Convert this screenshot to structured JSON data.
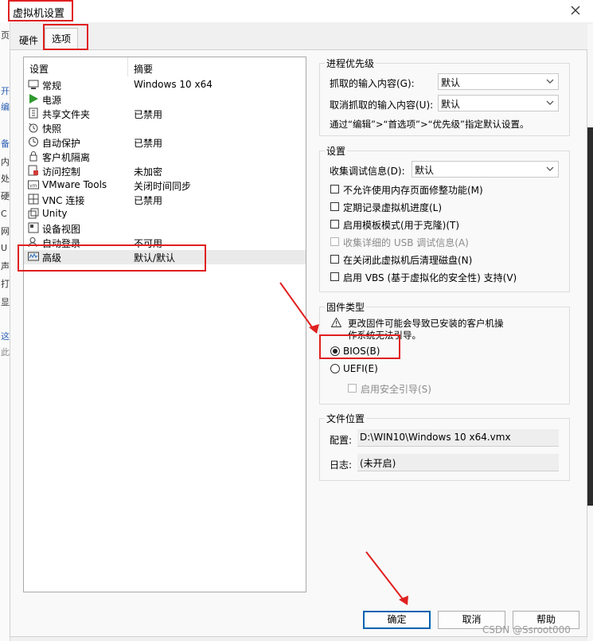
{
  "window": {
    "title": "虚拟机设置"
  },
  "tabs": [
    {
      "label": "硬件"
    },
    {
      "label": "选项"
    }
  ],
  "settings_list": {
    "col_setting": "设置",
    "col_summary": "摘要",
    "items": [
      {
        "name": "常规",
        "summary": "Windows 10 x64",
        "icon": "general-icon"
      },
      {
        "name": "电源",
        "summary": "",
        "icon": "power-icon"
      },
      {
        "name": "共享文件夹",
        "summary": "已禁用",
        "icon": "shared-folder-icon"
      },
      {
        "name": "快照",
        "summary": "",
        "icon": "snapshot-icon"
      },
      {
        "name": "自动保护",
        "summary": "已禁用",
        "icon": "autoprotect-icon"
      },
      {
        "name": "客户机隔离",
        "summary": "",
        "icon": "isolation-icon"
      },
      {
        "name": "访问控制",
        "summary": "未加密",
        "icon": "access-control-icon"
      },
      {
        "name": "VMware Tools",
        "summary": "关闭时间同步",
        "icon": "vmware-tools-icon"
      },
      {
        "name": "VNC 连接",
        "summary": "已禁用",
        "icon": "vnc-icon"
      },
      {
        "name": "Unity",
        "summary": "",
        "icon": "unity-icon"
      },
      {
        "name": "设备视图",
        "summary": "",
        "icon": "device-view-icon"
      },
      {
        "name": "自动登录",
        "summary": "不可用",
        "icon": "autologin-icon"
      },
      {
        "name": "高级",
        "summary": "默认/默认",
        "icon": "advanced-icon"
      }
    ]
  },
  "process_priority": {
    "title": "进程优先级",
    "grabbed_label": "抓取的输入内容(G):",
    "grabbed_value": "默认",
    "ungrabbed_label": "取消抓取的输入内容(U):",
    "ungrabbed_value": "默认",
    "hint": "通过“编辑”>“首选项”>“优先级”指定默认设置。"
  },
  "settings_group": {
    "title": "设置",
    "collect_label": "收集调试信息(D):",
    "collect_value": "默认",
    "checkboxes": [
      {
        "label": "不允许使用内存页面修整功能(M)",
        "checked": false,
        "enabled": true
      },
      {
        "label": "定期记录虚拟机进度(L)",
        "checked": false,
        "enabled": true
      },
      {
        "label": "启用模板模式(用于克隆)(T)",
        "checked": false,
        "enabled": true
      },
      {
        "label": "收集详细的 USB 调试信息(A)",
        "checked": false,
        "enabled": false
      },
      {
        "label": "在关闭此虚拟机后清理磁盘(N)",
        "checked": false,
        "enabled": true
      },
      {
        "label": "启用 VBS (基于虚拟化的安全性) 支持(V)",
        "checked": false,
        "enabled": true
      }
    ]
  },
  "firmware": {
    "title": "固件类型",
    "warning": "更改固件可能会导致已安装的客户机操作系统无法引导。",
    "bios_label": "BIOS(B)",
    "uefi_label": "UEFI(E)",
    "secure_boot_label": "启用安全引导(S)",
    "selected": "BIOS(B)"
  },
  "file_location": {
    "title": "文件位置",
    "config_label": "配置:",
    "config_value": "D:\\WIN10\\Windows 10 x64.vmx",
    "log_label": "日志:",
    "log_value": "(未开启)"
  },
  "buttons": {
    "ok": "确定",
    "cancel": "取消",
    "help": "帮助"
  },
  "watermark": "CSDN @Ssroot000",
  "colors": {
    "annotation_red": "#e02020",
    "default_button_border": "#0063b1"
  }
}
